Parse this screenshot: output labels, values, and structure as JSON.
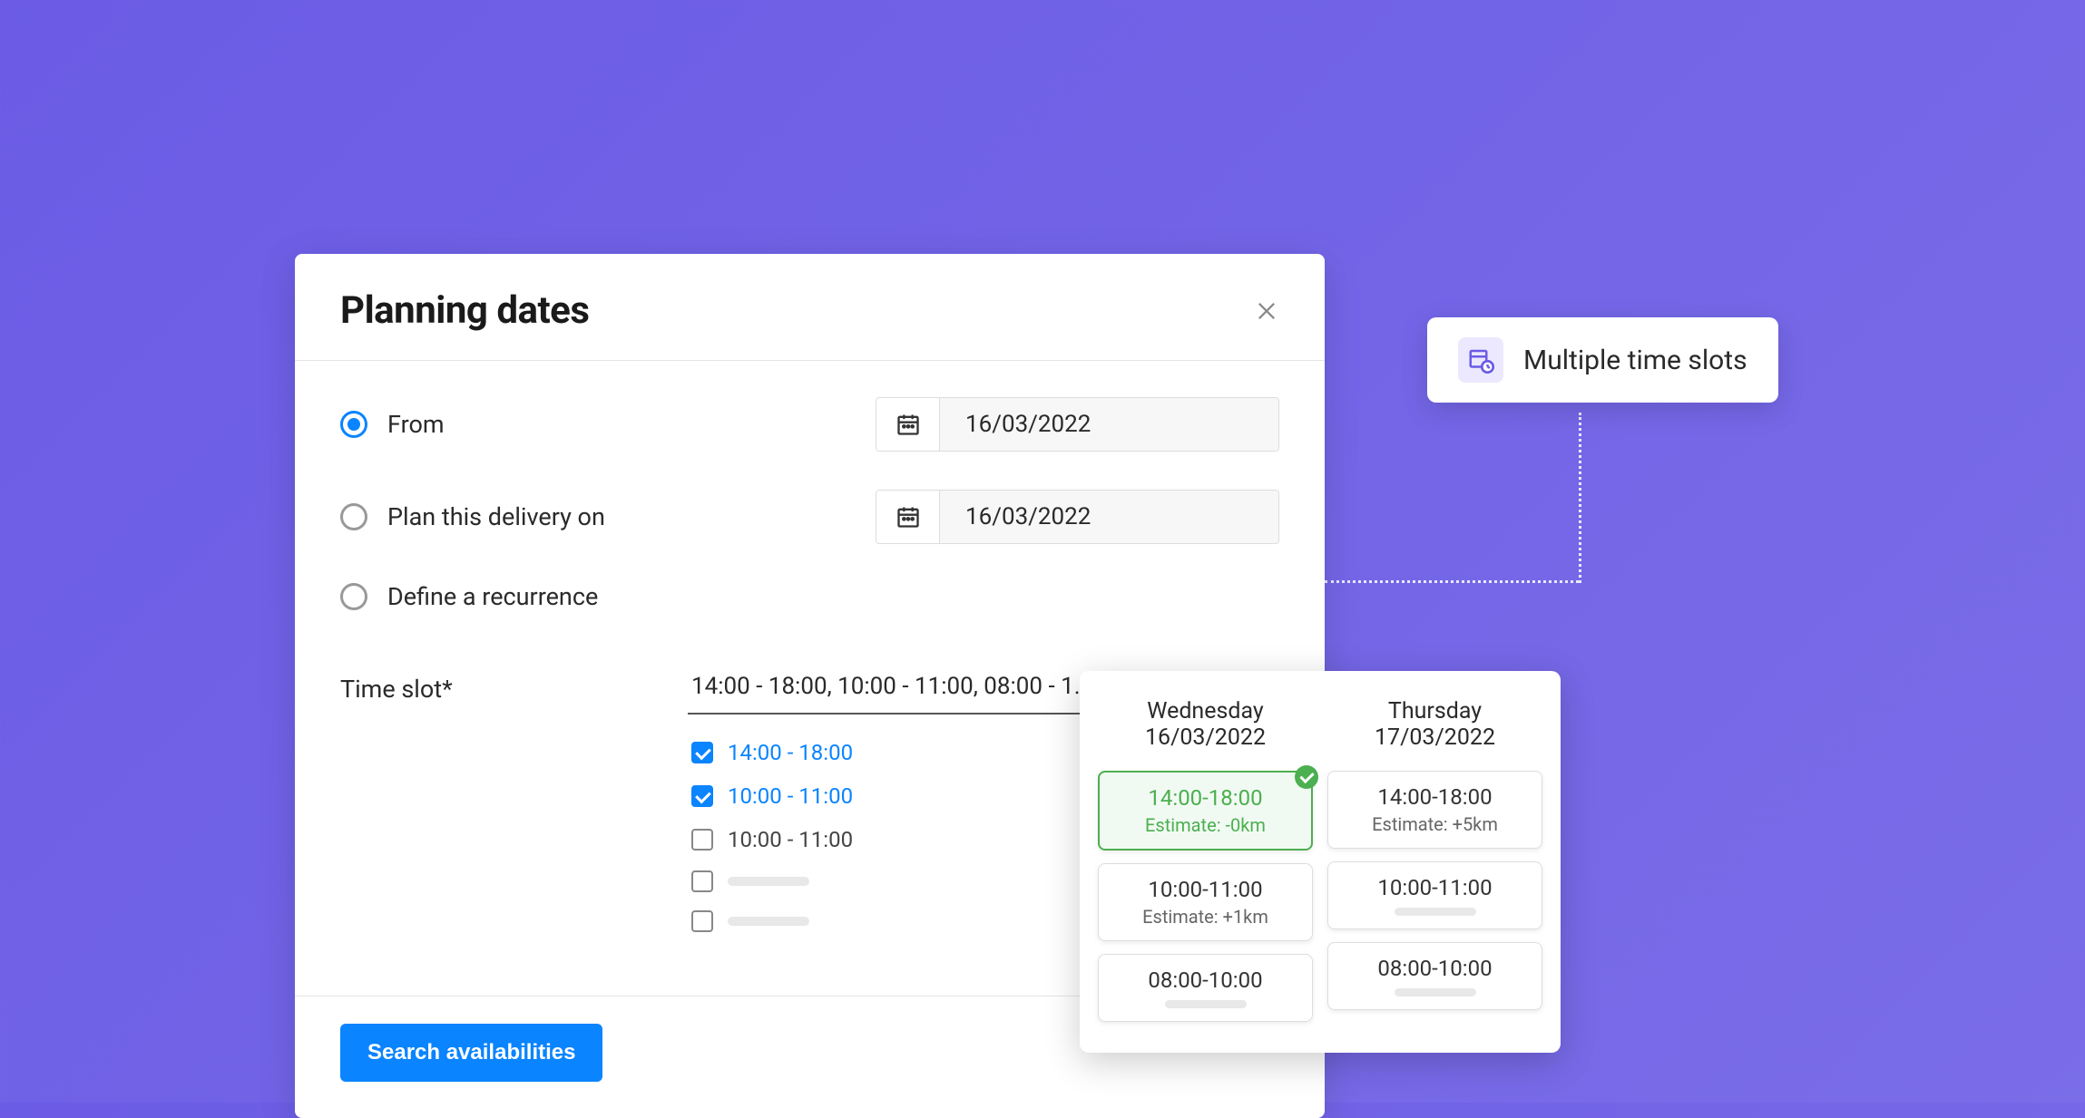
{
  "modal": {
    "title": "Planning dates",
    "options": {
      "from": {
        "label": "From",
        "date": "16/03/2022",
        "selected": true
      },
      "plan_on": {
        "label": "Plan this delivery on",
        "date": "16/03/2022",
        "selected": false
      },
      "recurrence": {
        "label": "Define a recurrence",
        "selected": false
      }
    },
    "timeslot": {
      "label": "Time slot*",
      "summary": "14:00 - 18:00, 10:00 - 11:00, 08:00 - 1...",
      "options": [
        {
          "label": "14:00 - 18:00",
          "checked": true
        },
        {
          "label": "10:00 - 11:00",
          "checked": true
        },
        {
          "label": "10:00 - 11:00",
          "checked": false
        },
        {
          "label": "",
          "checked": false
        },
        {
          "label": "",
          "checked": false
        }
      ]
    },
    "search_button": "Search availabilities"
  },
  "callout": {
    "label": "Multiple time slots"
  },
  "availability": {
    "columns": [
      {
        "day": "Wednesday",
        "date": "16/03/2022",
        "slots": [
          {
            "time": "14:00-18:00",
            "estimate": "Estimate: -0km",
            "selected": true
          },
          {
            "time": "10:00-11:00",
            "estimate": "Estimate: +1km",
            "selected": false
          },
          {
            "time": "08:00-10:00",
            "estimate": "",
            "selected": false
          }
        ]
      },
      {
        "day": "Thursday",
        "date": "17/03/2022",
        "slots": [
          {
            "time": "14:00-18:00",
            "estimate": "Estimate: +5km",
            "selected": false
          },
          {
            "time": "10:00-11:00",
            "estimate": "",
            "selected": false
          },
          {
            "time": "08:00-10:00",
            "estimate": "",
            "selected": false
          }
        ]
      }
    ]
  }
}
